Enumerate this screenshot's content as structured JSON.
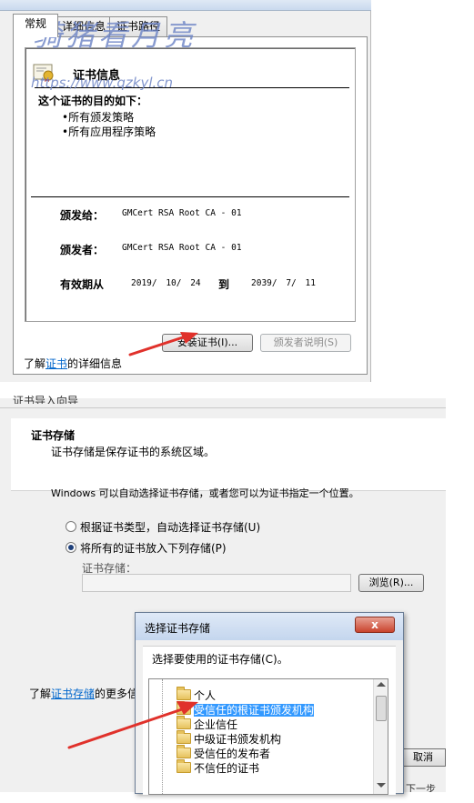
{
  "top_dialog": {
    "tabs": [
      "常规",
      "详细信息",
      "证书路径"
    ],
    "panel_title": "证书信息",
    "purpose_heading": "这个证书的目的如下：",
    "purposes": [
      "•所有颁发策略",
      "•所有应用程序策略"
    ],
    "issued_to_label": "颁发给：",
    "issued_to_value": "GMCert RSA Root CA - 01",
    "issued_by_label": "颁发者：",
    "issued_by_value": "GMCert RSA Root CA - 01",
    "valid_label": "有效期从",
    "valid_from": "2019/ 10/ 24",
    "valid_to_word": "到",
    "valid_to": "2039/ 7/ 11",
    "install_button": "安装证书(I)...",
    "issuer_statement_button": "颁发者说明(S)",
    "footer_prefix": "了解",
    "footer_link": "证书",
    "footer_suffix": "的详细信息"
  },
  "watermark": {
    "title": "骑猪看月亮",
    "url": "https://www.qzkyl.cn"
  },
  "wizard": {
    "window_title": "证书导入向导",
    "heading": "证书存储",
    "subheading": "证书存储是保存证书的系统区域。",
    "description": "Windows 可以自动选择证书存储，或者您可以为证书指定一个位置。",
    "radio_auto": "根据证书类型，自动选择证书存储(U)",
    "radio_manual": "将所有的证书放入下列存储(P)",
    "store_label": "证书存储：",
    "store_value": "",
    "browse_button": "浏览(R)...",
    "footer_prefix": "了解",
    "footer_link": "证书存储",
    "footer_suffix": "的更多信",
    "cancel_button": "取消",
    "next_partial": "下一步"
  },
  "store_popup": {
    "title": "选择证书存储",
    "instruction": "选择要使用的证书存储(C)。",
    "stores": [
      "个人",
      "受信任的根证书颁发机构",
      "企业信任",
      "中级证书颁发机构",
      "受信任的发布者",
      "不信任的证书"
    ],
    "selected_index": 1,
    "close_symbol": "x"
  },
  "colors": {
    "accent_arrow": "#e0312b",
    "selection": "#3399ff",
    "link": "#0066cc"
  }
}
